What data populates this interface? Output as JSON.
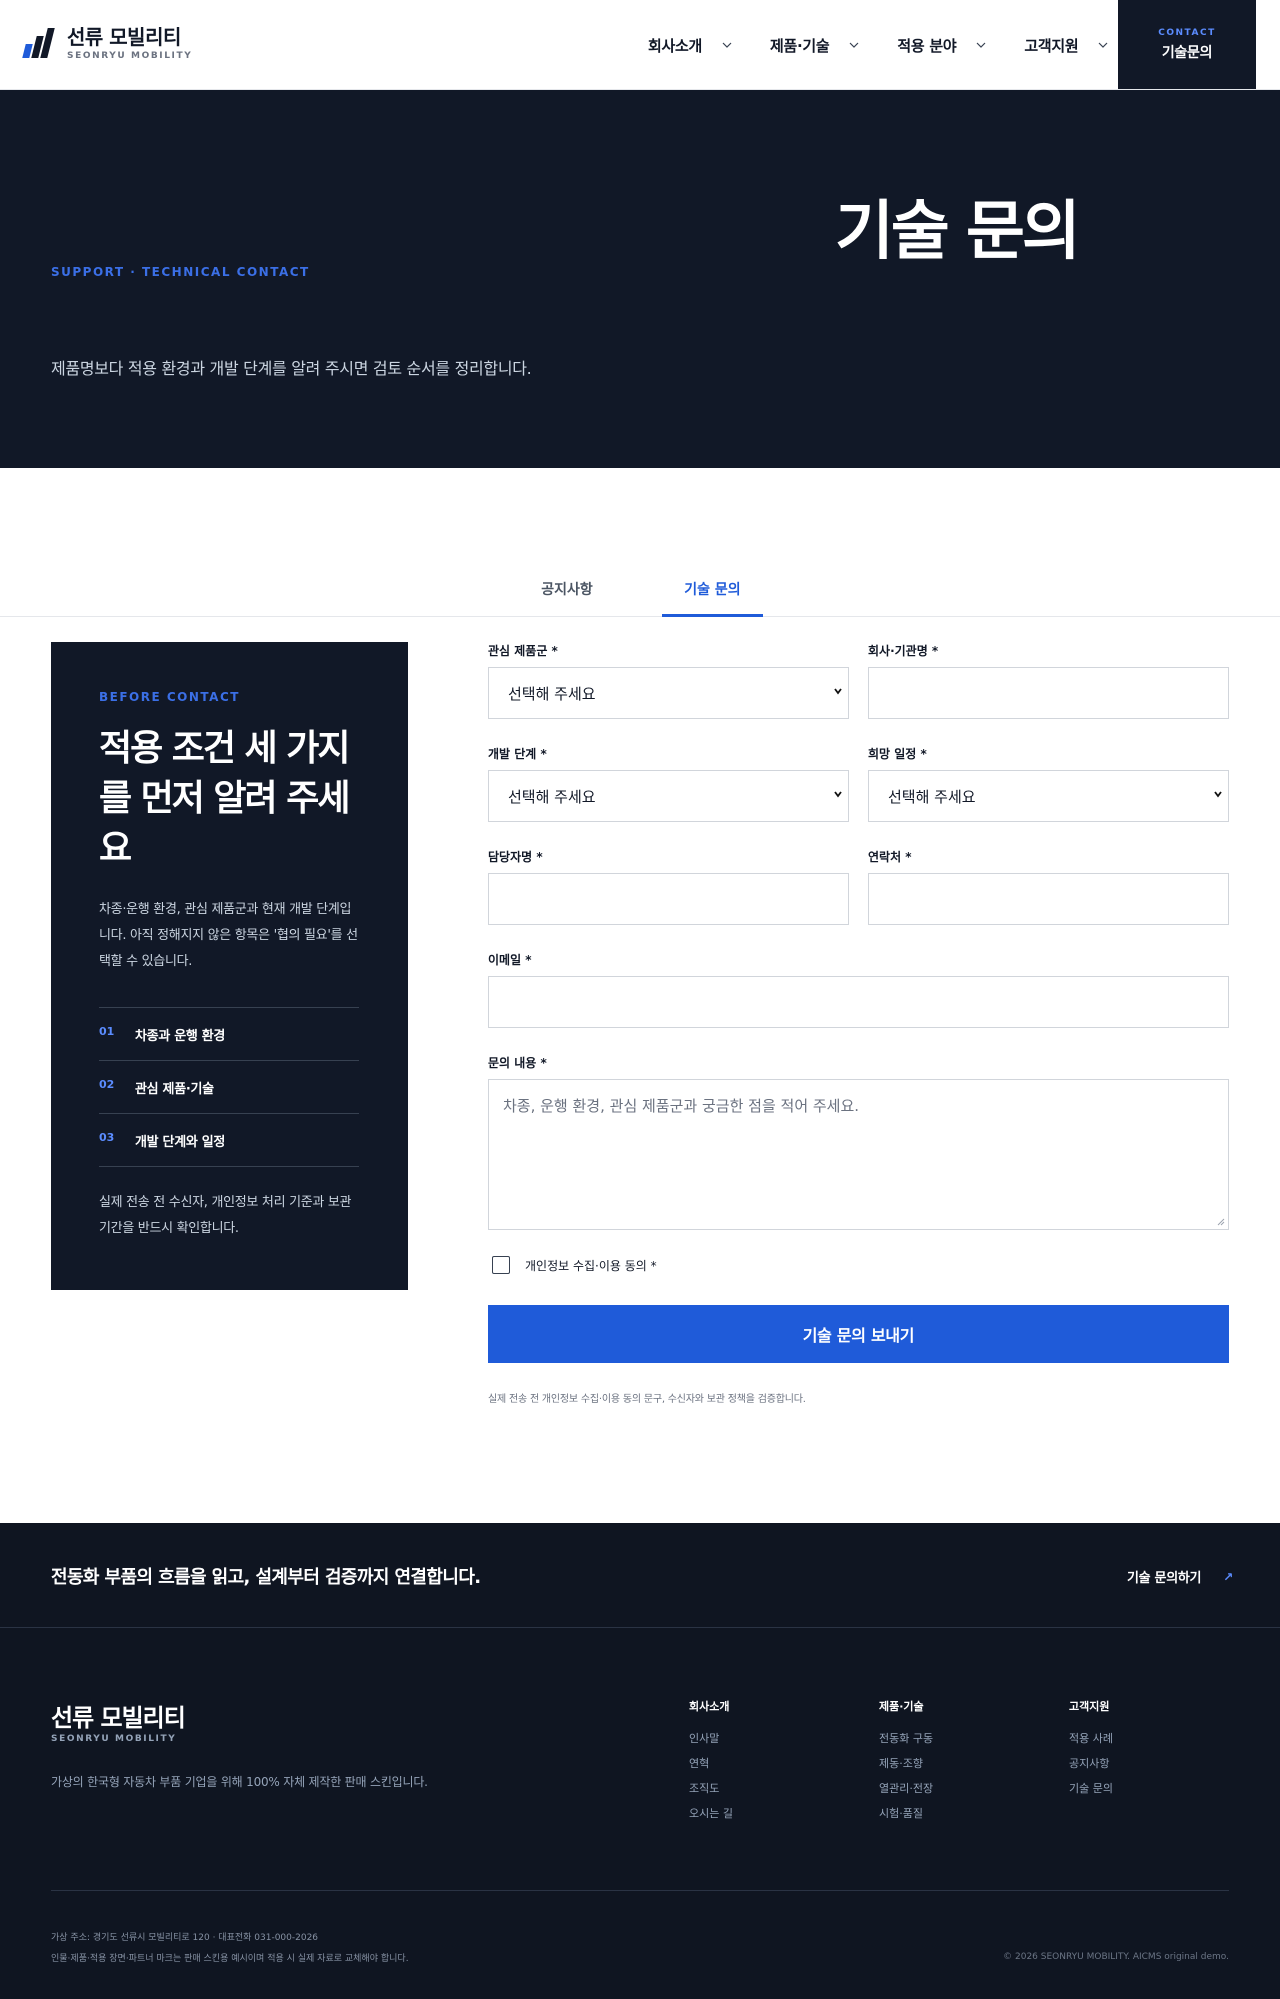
{
  "header": {
    "logo_name": "선류 모빌리티",
    "logo_sub": "SEONRYU MOBILITY",
    "nav": [
      {
        "label": "회사소개"
      },
      {
        "label": "제품·기술"
      },
      {
        "label": "적용 분야"
      },
      {
        "label": "고객지원"
      }
    ],
    "contact_small": "CONTACT",
    "contact_big": "기술문의"
  },
  "hero": {
    "eyebrow": "SUPPORT · TECHNICAL CONTACT",
    "title": "기술 문의",
    "desc": "제품명보다 적용 환경과 개발 단계를 알려 주시면 검토 순서를 정리합니다."
  },
  "tabs": [
    {
      "label": "공지사항",
      "active": false
    },
    {
      "label": "기술 문의",
      "active": true
    }
  ],
  "side": {
    "eyebrow": "BEFORE CONTACT",
    "title": "적용 조건 세 가지를 먼저 알려 주세요",
    "desc": "차종·운행 환경, 관심 제품군과 현재 개발 단계입니다. 아직 정해지지 않은 항목은 '협의 필요'를 선택할 수 있습니다.",
    "items": [
      {
        "num": "01",
        "label": "차종과 운행 환경"
      },
      {
        "num": "02",
        "label": "관심 제품·기술"
      },
      {
        "num": "03",
        "label": "개발 단계와 일정"
      }
    ],
    "note": "실제 전송 전 수신자, 개인정보 처리 기준과 보관 기간을 반드시 확인합니다."
  },
  "form": {
    "product_label": "관심 제품군 *",
    "product_value": "선택해 주세요",
    "company_label": "회사·기관명 *",
    "company_value": "",
    "stage_label": "개발 단계 *",
    "stage_value": "선택해 주세요",
    "schedule_label": "희망 일정 *",
    "schedule_value": "선택해 주세요",
    "manager_label": "담당자명 *",
    "manager_value": "",
    "phone_label": "연락처 *",
    "phone_value": "",
    "email_label": "이메일 *",
    "email_value": "",
    "message_label": "문의 내용 *",
    "message_placeholder": "차종, 운행 환경, 관심 제품군과 궁금한 점을 적어 주세요.",
    "consent_label": "개인정보 수집·이용 동의 *",
    "consent_checked": false,
    "submit_label": "기술 문의 보내기",
    "note": "실제 전송 전 개인정보 수집·이용 동의 문구, 수신자와 보관 정책을 검증합니다."
  },
  "cta": {
    "text": "전동화 부품의 흐름을 읽고, 설계부터 검증까지 연결합니다.",
    "link_label": "기술 문의하기"
  },
  "footer": {
    "logo_name": "선류 모빌리티",
    "logo_sub": "SEONRYU MOBILITY",
    "desc": "가상의 한국형 자동차 부품 기업을 위해 100% 자체 제작한 판매 스킨입니다.",
    "columns": [
      {
        "heading": "회사소개",
        "items": [
          "인사말",
          "연혁",
          "조직도",
          "오시는 길"
        ]
      },
      {
        "heading": "제품·기술",
        "items": [
          "전동화 구동",
          "제동·조향",
          "열관리·전장",
          "시험·품질"
        ]
      },
      {
        "heading": "고객지원",
        "items": [
          "적용 사례",
          "공지사항",
          "기술 문의"
        ]
      }
    ],
    "address": "가상 주소: 경기도 선류시 모빌리티로 120 · 대표전화 031-000-2026",
    "notice": "인물·제품·적용 장면·파트너 마크는 판매 스킨용 예시이며 적용 시 실제 자료로 교체해야 합니다.",
    "copyright": "© 2026 SEONRYU MOBILITY. AICMS original demo."
  },
  "colors": {
    "accent": "#1f5bd9",
    "dark": "#111827",
    "footer_bg": "#0f1521"
  }
}
